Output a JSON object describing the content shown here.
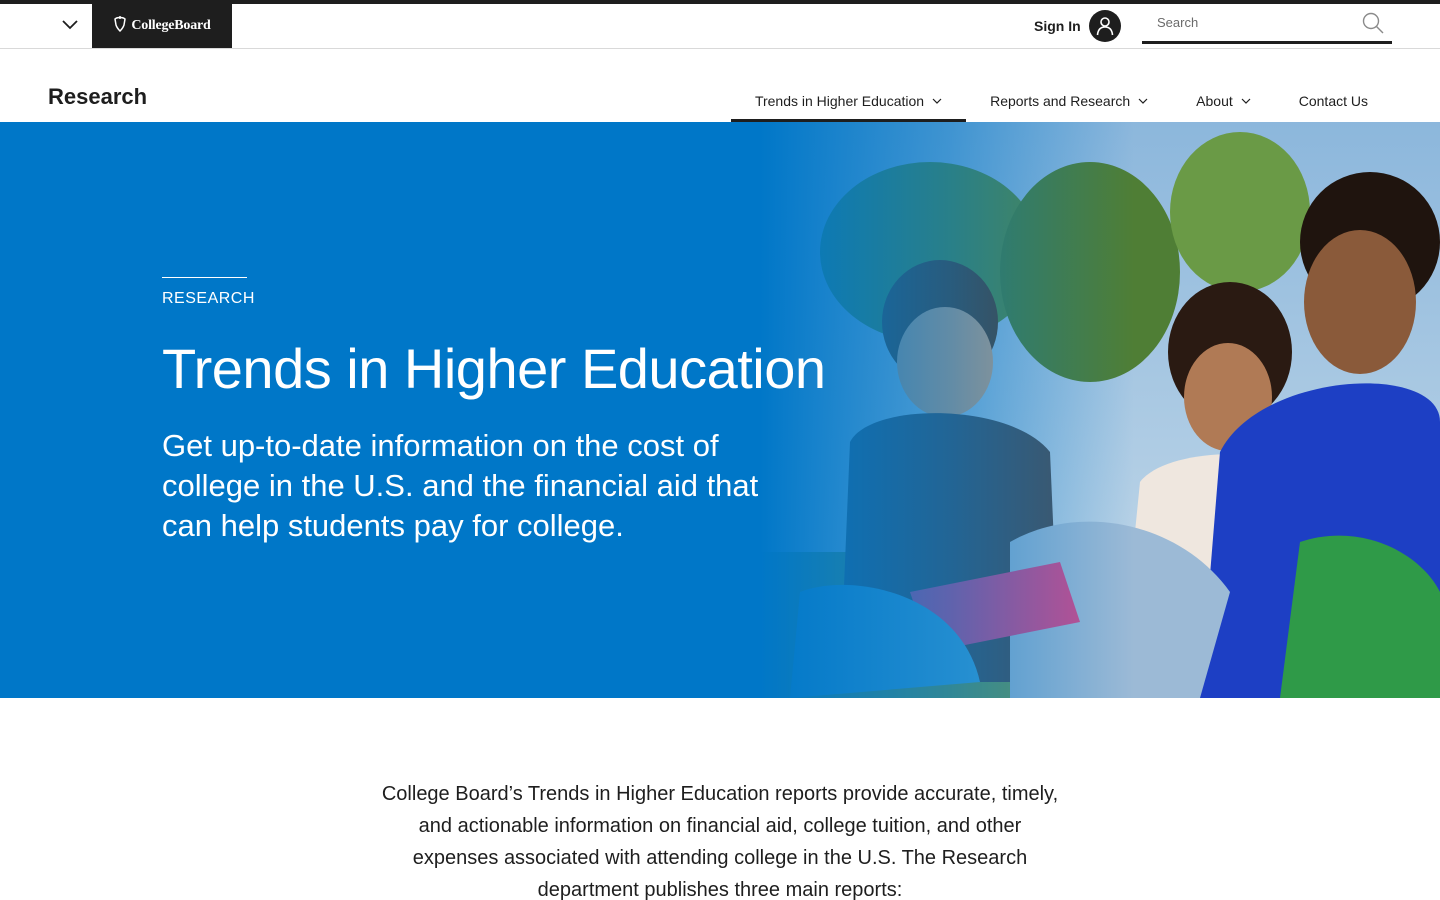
{
  "global_header": {
    "logo_text": "CollegeBoard",
    "menu_icon": "chevron-down-icon",
    "signin_label": "Sign In",
    "avatar_icon": "user-icon",
    "search": {
      "placeholder": "Search",
      "value": "",
      "icon": "search-icon"
    }
  },
  "local_nav": {
    "site_title": "Research",
    "items": [
      {
        "label": "Trends in Higher Education",
        "has_dropdown": true,
        "active": true
      },
      {
        "label": "Reports and Research",
        "has_dropdown": true,
        "active": false
      },
      {
        "label": "About",
        "has_dropdown": true,
        "active": false
      },
      {
        "label": "Contact Us",
        "has_dropdown": false,
        "active": false
      }
    ]
  },
  "hero": {
    "eyebrow": "RESEARCH",
    "title": "Trends in Higher Education",
    "description": "Get up-to-date information on the cost of college in the U.S. and the financial aid that can help students pay for college.",
    "background_color": "#0077c8"
  },
  "intro": {
    "text": "College Board’s Trends in Higher Education reports provide accurate, timely, and actionable information on financial aid, college tuition, and other expenses associated with attending college in the U.S. The Research department publishes three main reports:"
  }
}
